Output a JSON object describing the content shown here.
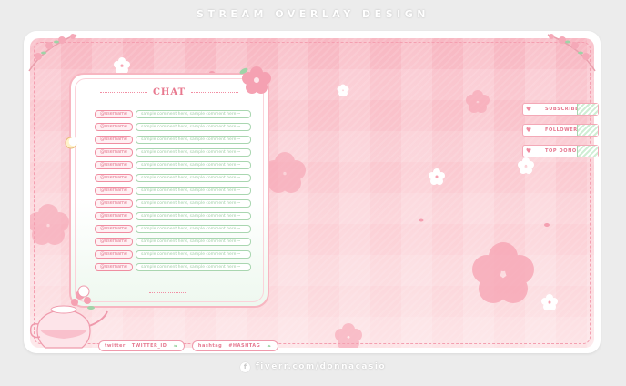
{
  "header": {
    "title": "STREAM OVERLAY DESIGN"
  },
  "chat": {
    "title": "CHAT",
    "messages": [
      {
        "user": "@username",
        "text": "sample comment here, sample comment here ~"
      },
      {
        "user": "@username",
        "text": "sample comment here, sample comment here ~"
      },
      {
        "user": "@username",
        "text": "sample comment here, sample comment here ~"
      },
      {
        "user": "@username",
        "text": "sample comment here, sample comment here ~"
      },
      {
        "user": "@username",
        "text": "sample comment here, sample comment here ~"
      },
      {
        "user": "@username",
        "text": "sample comment here, sample comment here ~"
      },
      {
        "user": "@username",
        "text": "sample comment here, sample comment here ~"
      },
      {
        "user": "@username",
        "text": "sample comment here, sample comment here ~"
      },
      {
        "user": "@username",
        "text": "sample comment here, sample comment here ~"
      },
      {
        "user": "@username",
        "text": "sample comment here, sample comment here ~"
      },
      {
        "user": "@username",
        "text": "sample comment here, sample comment here ~"
      },
      {
        "user": "@username",
        "text": "sample comment here, sample comment here ~"
      },
      {
        "user": "@username",
        "text": "sample comment here, sample comment here ~"
      }
    ]
  },
  "side_buttons": [
    {
      "label": "SUBSCRIBER",
      "icon": "heart-icon"
    },
    {
      "label": "FOLLOWER",
      "icon": "heart-icon"
    },
    {
      "label": "TOP DONOR",
      "icon": "heart-icon"
    }
  ],
  "socials": {
    "twitter_label": "twitter",
    "twitter_value": "TWITTER_ID",
    "hashtag_label": "hashtag",
    "hashtag_value": "#HASHTAG"
  },
  "credit": {
    "text": "fiverr.com/donnacasio",
    "icon": "fiverr-icon"
  },
  "colors": {
    "pink_accent": "#f28ea3",
    "mint_accent": "#a9d6b0",
    "background": "#ececec"
  }
}
